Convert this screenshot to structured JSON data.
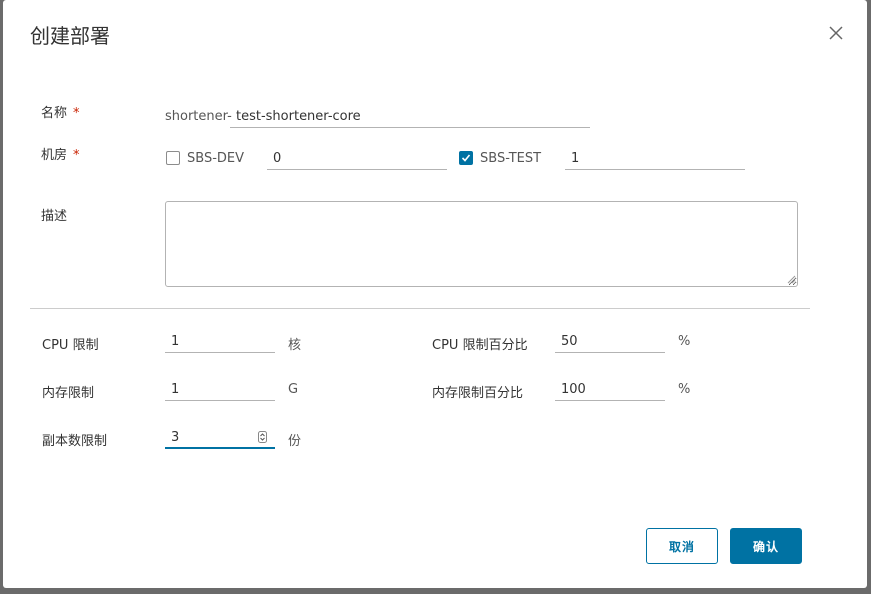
{
  "dialog": {
    "title": "创建部署"
  },
  "form": {
    "name": {
      "label": "名称",
      "required_mark": "*",
      "prefix": "shortener-",
      "value": "test-shortener-core"
    },
    "datacenter": {
      "label": "机房",
      "required_mark": "*",
      "options": [
        {
          "label": "SBS-DEV",
          "checked": false,
          "value": "0"
        },
        {
          "label": "SBS-TEST",
          "checked": true,
          "value": "1"
        }
      ]
    },
    "description": {
      "label": "描述",
      "value": ""
    },
    "cpu_limit": {
      "label": "CPU 限制",
      "value": "1",
      "unit": "核"
    },
    "cpu_limit_percent": {
      "label": "CPU 限制百分比",
      "value": "50",
      "unit": "%"
    },
    "memory_limit": {
      "label": "内存限制",
      "value": "1",
      "unit": "G"
    },
    "memory_limit_percent": {
      "label": "内存限制百分比",
      "value": "100",
      "unit": "%"
    },
    "replicas": {
      "label": "副本数限制",
      "value": "3",
      "unit": "份"
    }
  },
  "footer": {
    "cancel_label": "取消",
    "confirm_label": "确认"
  },
  "colors": {
    "accent": "#0072a3",
    "required": "#c92100"
  }
}
